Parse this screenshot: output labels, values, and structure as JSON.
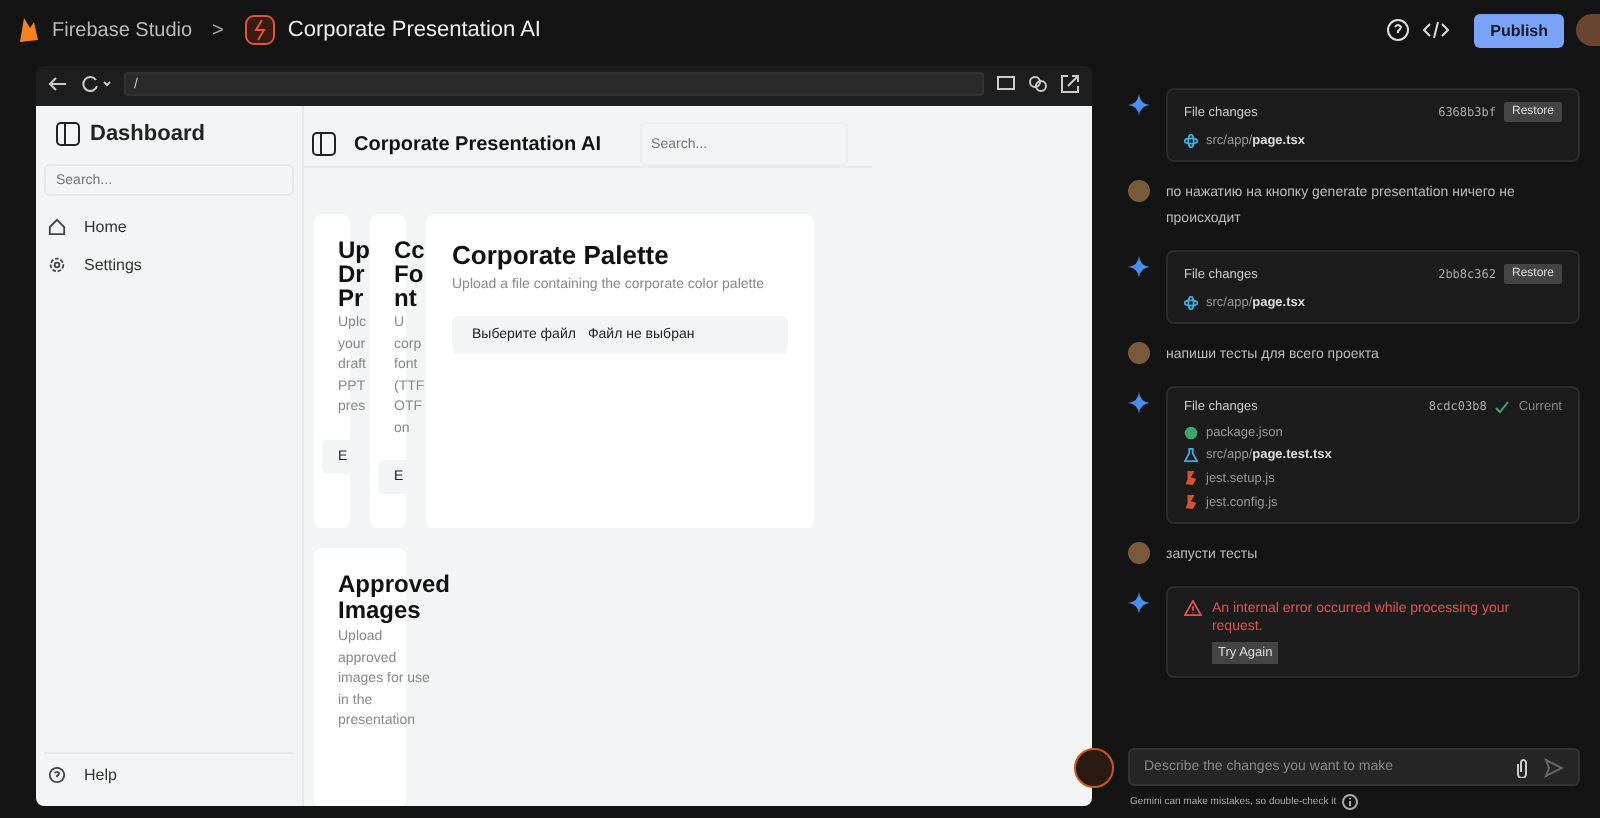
{
  "topbar": {
    "brand": "Firebase Studio",
    "separator": ">",
    "project": "Corporate Presentation AI",
    "publish": "Publish"
  },
  "preview": {
    "url": "/",
    "sidebar": {
      "title": "Dashboard",
      "search_placeholder": "Search...",
      "items": [
        {
          "label": "Home"
        },
        {
          "label": "Settings"
        }
      ],
      "help": "Help"
    },
    "header": {
      "title": "Corporate Presentation AI",
      "search_placeholder": "Search..."
    },
    "cards": [
      {
        "kind": "narrow",
        "title_lines": [
          "Up",
          "Dr",
          "Pr"
        ],
        "desc_lines": [
          "Uplc",
          "your",
          "draft",
          "PPT",
          "pres"
        ],
        "button": "E"
      },
      {
        "kind": "narrow",
        "title_lines": [
          "Cc",
          "Fo",
          "nt"
        ],
        "desc_lines": [
          "U",
          "corp",
          "font",
          "(TTF",
          "OTF",
          "on"
        ],
        "button": "E"
      },
      {
        "kind": "wide",
        "title": "Corporate Palette",
        "description": "Upload a file containing the corporate color palette",
        "file_button": "Выберите файл",
        "file_status": "Файл не выбран"
      },
      {
        "kind": "tall",
        "title": "Approved Images",
        "description": "Upload approved images for use in the presentation"
      }
    ]
  },
  "chat": {
    "messages": [
      {
        "kind": "changes",
        "title": "File changes",
        "hash": "6368b3bf",
        "restore": "Restore",
        "files": [
          {
            "kind": "component",
            "path": "src/app/**page.tsx**"
          }
        ]
      },
      {
        "kind": "user",
        "text": "по нажатию на кнопку generate presentation ничего не происходит"
      },
      {
        "kind": "changes",
        "title": "File changes",
        "hash": "2bb8c362",
        "restore": "Restore",
        "files": [
          {
            "kind": "component",
            "path": "src/app/**page.tsx**"
          }
        ]
      },
      {
        "kind": "user",
        "text": "напиши тесты для всего проекта"
      },
      {
        "kind": "changes",
        "title": "File changes",
        "hash": "8cdc03b8",
        "current": "Current",
        "files": [
          {
            "kind": "package",
            "path": "package.json"
          },
          {
            "kind": "test",
            "path": "src/app/**page.test.tsx**"
          },
          {
            "kind": "config",
            "path": "jest.setup.js"
          },
          {
            "kind": "config",
            "path": "jest.config.js"
          }
        ]
      },
      {
        "kind": "user",
        "text": "запусти тесты"
      },
      {
        "kind": "error",
        "text": "An internal error occurred while processing your request.",
        "button": "Try Again"
      }
    ],
    "input_placeholder": "Describe the changes you want to make",
    "disclaimer": "Gemini can make mistakes, so double-check it"
  }
}
